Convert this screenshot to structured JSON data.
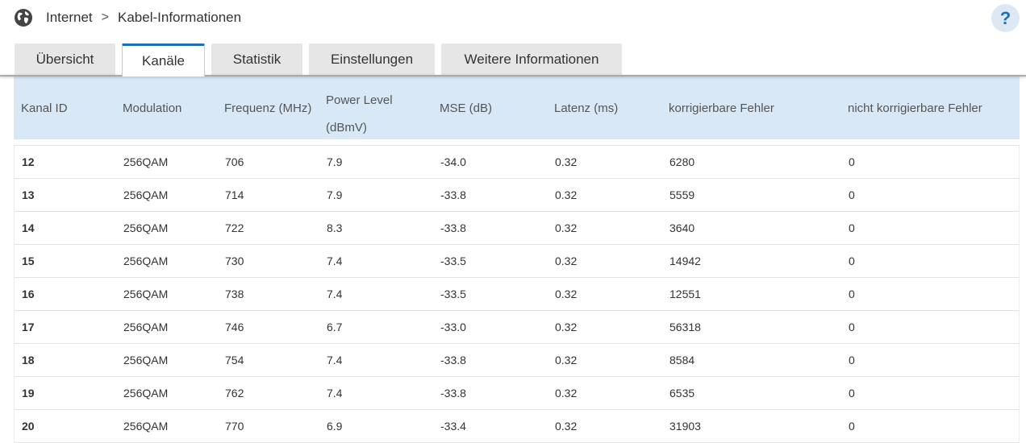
{
  "breadcrumb": {
    "items": [
      "Internet",
      "Kabel-Informationen"
    ],
    "separator": ">"
  },
  "help": {
    "label": "?"
  },
  "tabs": [
    {
      "label": "Übersicht",
      "active": false
    },
    {
      "label": "Kanäle",
      "active": true
    },
    {
      "label": "Statistik",
      "active": false
    },
    {
      "label": "Einstellungen",
      "active": false
    },
    {
      "label": "Weitere Informationen",
      "active": false
    }
  ],
  "table": {
    "headers": [
      "Kanal ID",
      "Modulation",
      "Frequenz (MHz)",
      [
        "Power Level",
        "(dBmV)"
      ],
      "MSE (dB)",
      "Latenz (ms)",
      "korrigierbare Fehler",
      "nicht korrigierbare Fehler"
    ],
    "rows": [
      [
        "12",
        "256QAM",
        "706",
        "7.9",
        "-34.0",
        "0.32",
        "6280",
        "0"
      ],
      [
        "13",
        "256QAM",
        "714",
        "7.9",
        "-33.8",
        "0.32",
        "5559",
        "0"
      ],
      [
        "14",
        "256QAM",
        "722",
        "8.3",
        "-33.8",
        "0.32",
        "3640",
        "0"
      ],
      [
        "15",
        "256QAM",
        "730",
        "7.4",
        "-33.5",
        "0.32",
        "14942",
        "0"
      ],
      [
        "16",
        "256QAM",
        "738",
        "7.4",
        "-33.5",
        "0.32",
        "12551",
        "0"
      ],
      [
        "17",
        "256QAM",
        "746",
        "6.7",
        "-33.0",
        "0.32",
        "56318",
        "0"
      ],
      [
        "18",
        "256QAM",
        "754",
        "7.4",
        "-33.8",
        "0.32",
        "8584",
        "0"
      ],
      [
        "19",
        "256QAM",
        "762",
        "7.4",
        "-33.8",
        "0.32",
        "6535",
        "0"
      ],
      [
        "20",
        "256QAM",
        "770",
        "6.9",
        "-33.4",
        "0.32",
        "31903",
        "0"
      ]
    ]
  },
  "colors": {
    "accent": "#1f6fb6",
    "header_bg": "#d8e8f6",
    "tab_bg": "#e6e6e6"
  },
  "icons": {
    "breadcrumb": "globe-icon",
    "separator": "chevron-right-icon",
    "help": "question-icon"
  }
}
